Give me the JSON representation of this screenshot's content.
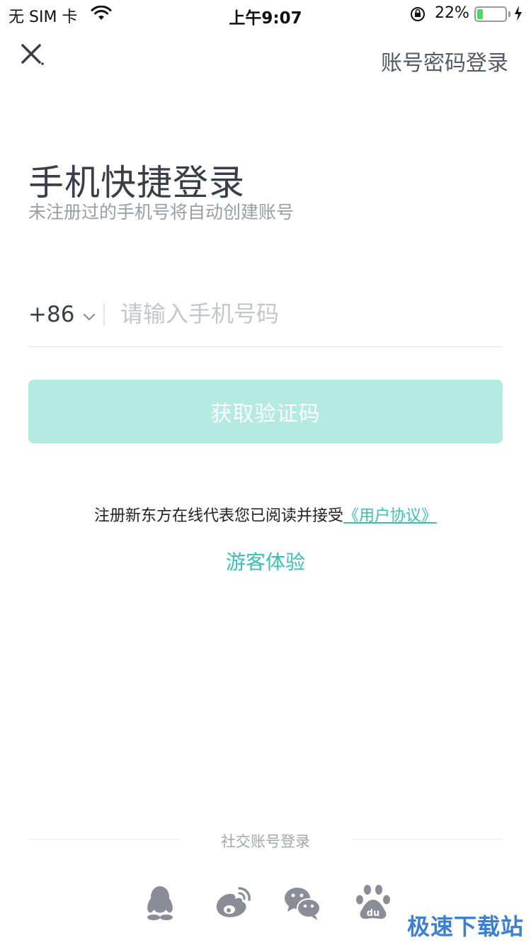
{
  "status_bar": {
    "carrier": "无 SIM 卡",
    "time": "上午9:07",
    "battery_percent": "22%",
    "battery_level": 0.22,
    "wifi_icon": "wifi-icon",
    "lock_icon": "rotation-lock-icon"
  },
  "nav": {
    "close_icon": "close-icon",
    "password_login": "账号密码登录"
  },
  "header": {
    "title": "手机快捷登录",
    "subtitle": "未注册过的手机号将自动创建账号"
  },
  "phone": {
    "country_code": "+86",
    "placeholder": "请输入手机号码",
    "value": ""
  },
  "get_code_button": "获取验证码",
  "agreement": {
    "text": "注册新东方在线代表您已阅读并接受",
    "link": "《用户协议》"
  },
  "guest_link": "游客体验",
  "social": {
    "label": "社交账号登录",
    "providers": [
      "qq-icon",
      "weibo-icon",
      "wechat-icon",
      "baidu-icon"
    ]
  },
  "watermark": "极速下载站",
  "colors": {
    "accent": "#36c2b4",
    "button_disabled": "#b3ebe3",
    "icon_gray": "#8a8d98"
  }
}
